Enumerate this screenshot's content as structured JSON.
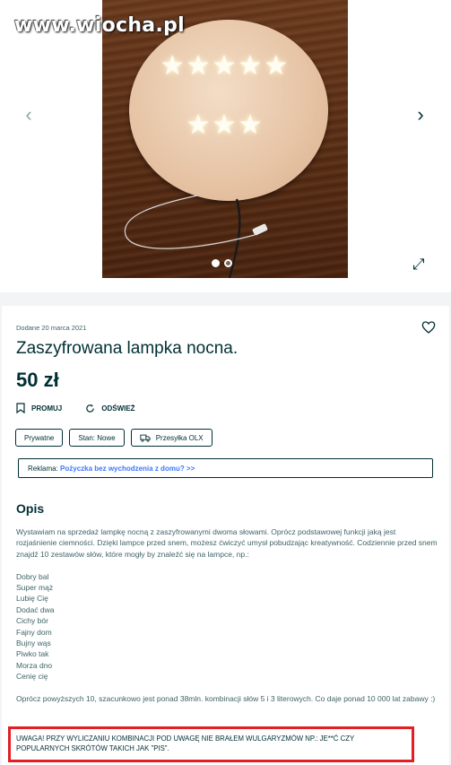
{
  "watermark": "www.wiocha.pl",
  "gallery": {
    "stars_row1": "★★★★★",
    "stars_row2": "★★★",
    "prev_arrow": "‹",
    "next_arrow": "›",
    "expand_glyph": "⤢",
    "dots": [
      {
        "active": true
      },
      {
        "active": false
      }
    ]
  },
  "listing": {
    "date": "Dodane 20 marca 2021",
    "title": "Zaszyfrowana lampka nocna.",
    "price": "50 zł",
    "promote_label": "PROMUJ",
    "refresh_label": "ODŚWIEŻ",
    "tags": [
      "Prywatne",
      "Stan: Nowe",
      "Przesyłka OLX"
    ],
    "ad_prefix": "Reklama: ",
    "ad_link": "Pożyczka bez wychodzenia z domu? >>"
  },
  "description": {
    "heading": "Opis",
    "intro": "Wystawiam na sprzedaż lampkę nocną z zaszyfrowanymi dwoma słowami. Oprócz podstawowej funkcji jaką jest rozjaśnienie ciemności. Dzięki lampce przed snem, możesz ćwiczyć umysł pobudzając kreatywność. Codziennie przed snem znajdź 10 zestawów słów, które mogły by znaleźć się na lampce, np.:",
    "examples": [
      "Dobry bal",
      "Super mąż",
      "Lubię Cię",
      "Dodać dwa",
      "Cichy bór",
      "Fajny dom",
      "Bujny wąs",
      "Piwko tak",
      "Morza dno",
      "Cenię cię"
    ],
    "outro": "Oprócz powyższych 10, szacunkowo jest ponad 38mln. kombinacji słów 5 i 3 literowych. Co daje ponad 10 000 lat zabawy :)",
    "warning": "UWAGA! PRZY WYLICZANIU KOMBINACJI POD UWAGĘ NIE BRAŁEM WULGARYZMÓW NP.: JE**Ć CZY POPULARNYCH SKRÓTÓW TAKICH JAK \"PIS\"."
  },
  "colors": {
    "text_primary": "#002f34",
    "text_secondary": "#406367",
    "link": "#3a77ff",
    "highlight_border": "#e31e24"
  }
}
